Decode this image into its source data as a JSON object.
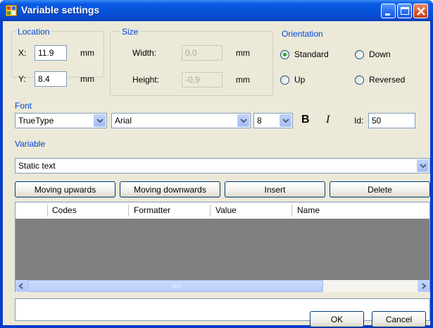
{
  "window": {
    "title": "Variable settings"
  },
  "location": {
    "label": "Location",
    "x_label": "X:",
    "x_value": "11.9",
    "x_unit": "mm",
    "y_label": "Y:",
    "y_value": "8.4",
    "y_unit": "mm"
  },
  "size": {
    "label": "Size",
    "width_label": "Width:",
    "width_value": "0,0",
    "width_unit": "mm",
    "height_label": "Height:",
    "height_value": "-0,9",
    "height_unit": "mm"
  },
  "orientation": {
    "label": "Orientation",
    "options": [
      {
        "label": "Standard",
        "selected": true
      },
      {
        "label": "Down",
        "selected": false
      },
      {
        "label": "Up",
        "selected": false
      },
      {
        "label": "Reversed",
        "selected": false
      }
    ]
  },
  "font": {
    "label": "Font",
    "type": "TrueType",
    "family": "Arial",
    "size": "8",
    "bold_label": "B",
    "italic_label": "I",
    "id_label": "Id:",
    "id_value": "50"
  },
  "variable": {
    "label": "Variable",
    "selected": "Static text"
  },
  "buttons": {
    "moving_up": "Moving upwards",
    "moving_down": "Moving downwards",
    "insert": "Insert",
    "delete": "Delete",
    "ok": "OK",
    "cancel": "Cancel"
  },
  "grid": {
    "columns": [
      "Codes",
      "Formatter",
      "Value",
      "Name"
    ]
  },
  "colors": {
    "group_label": "#0046d5",
    "dialog_bg": "#ece9d8",
    "titlebar": "#0653d8",
    "radio_dot": "#21a121"
  }
}
